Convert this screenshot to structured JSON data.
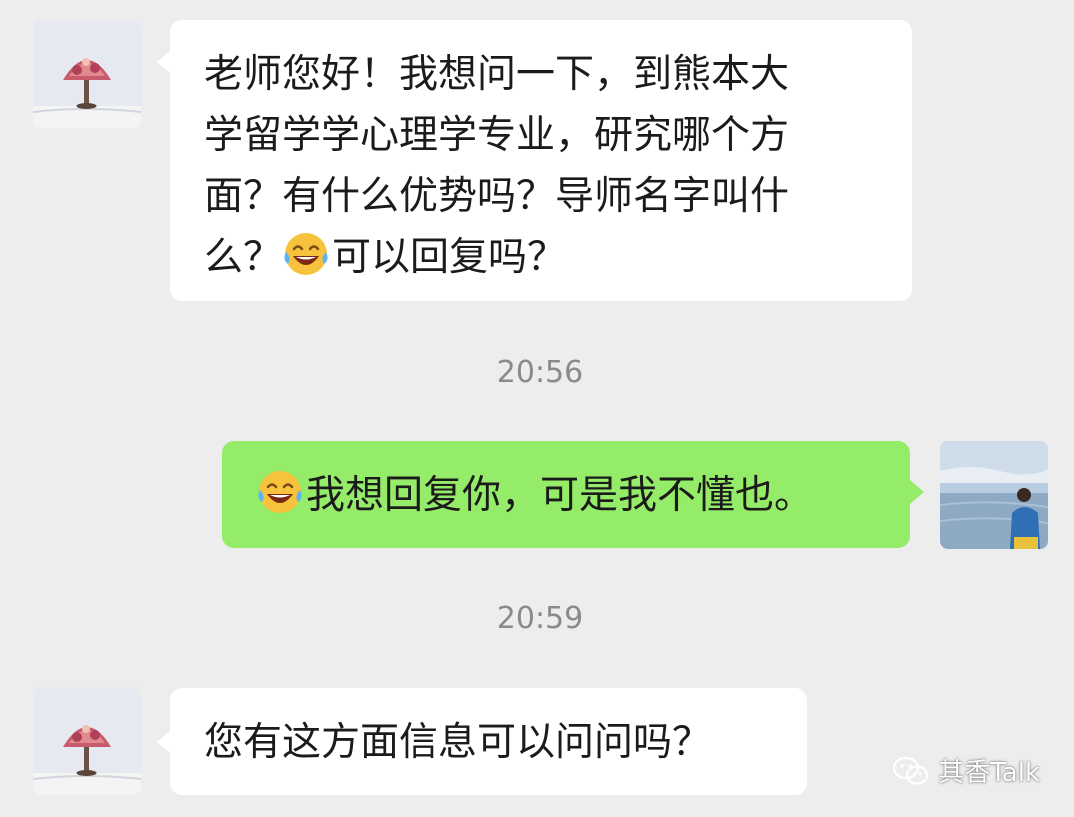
{
  "messages": [
    {
      "id": "m1",
      "direction": "incoming",
      "line1": "老师您好！我想问一下，到熊本大",
      "line2": "学留学学心理学专业，研究哪个方",
      "line3": "面？有什么优势吗？导师名字叫什",
      "line4_start": "么？",
      "line4_emoji": "laughing-tears-emoji",
      "line4_end": "可以回复吗？"
    },
    {
      "id": "m2",
      "direction": "outgoing",
      "emoji": "laughing-tears-emoji",
      "text": "我想回复你，可是我不懂也。"
    },
    {
      "id": "m3",
      "direction": "incoming",
      "text": "您有这方面信息可以问问吗？"
    }
  ],
  "timestamps": {
    "first": "20:56",
    "second": "20:59"
  },
  "watermark": {
    "text": "其香Talk",
    "icon": "wechat-icon"
  },
  "colors": {
    "background": "#ededed",
    "incoming_bubble": "#ffffff",
    "outgoing_bubble": "#95ec69",
    "timestamp": "#8a8a8a"
  }
}
